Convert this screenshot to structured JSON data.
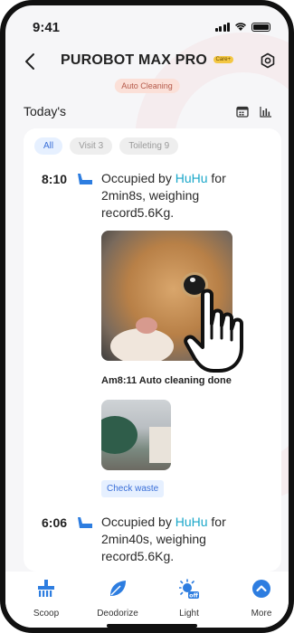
{
  "status_bar": {
    "time": "9:41"
  },
  "header": {
    "title": "PUROBOT MAX PRO",
    "care_badge": "Care+",
    "mode_badge": "Auto Cleaning"
  },
  "section": {
    "title": "Today's"
  },
  "filters": [
    "All",
    "Visit 3",
    "Toileting 9"
  ],
  "entries": [
    {
      "time": "8:10",
      "text_prefix": "Occupied by ",
      "pet": "HuHu",
      "text_suffix": " for 2min8s, weighing record5.6Kg.",
      "auto_note": "Am8:11 Auto cleaning done",
      "action_label": "Check waste"
    },
    {
      "time": "6:06",
      "text_prefix": "Occupied by ",
      "pet": "HuHu",
      "text_suffix": " for 2min40s, weighing record5.6Kg."
    }
  ],
  "bottom_nav": [
    {
      "label": "Scoop",
      "icon": "scoop-icon"
    },
    {
      "label": "Deodorize",
      "icon": "leaf-icon"
    },
    {
      "label": "Light",
      "icon": "light-off-icon"
    },
    {
      "label": "More",
      "icon": "chevron-up-circle-icon"
    }
  ],
  "colors": {
    "accent": "#3a6fd8",
    "pet_name": "#1aa7c9",
    "badge_bg": "#fbe0d8"
  }
}
